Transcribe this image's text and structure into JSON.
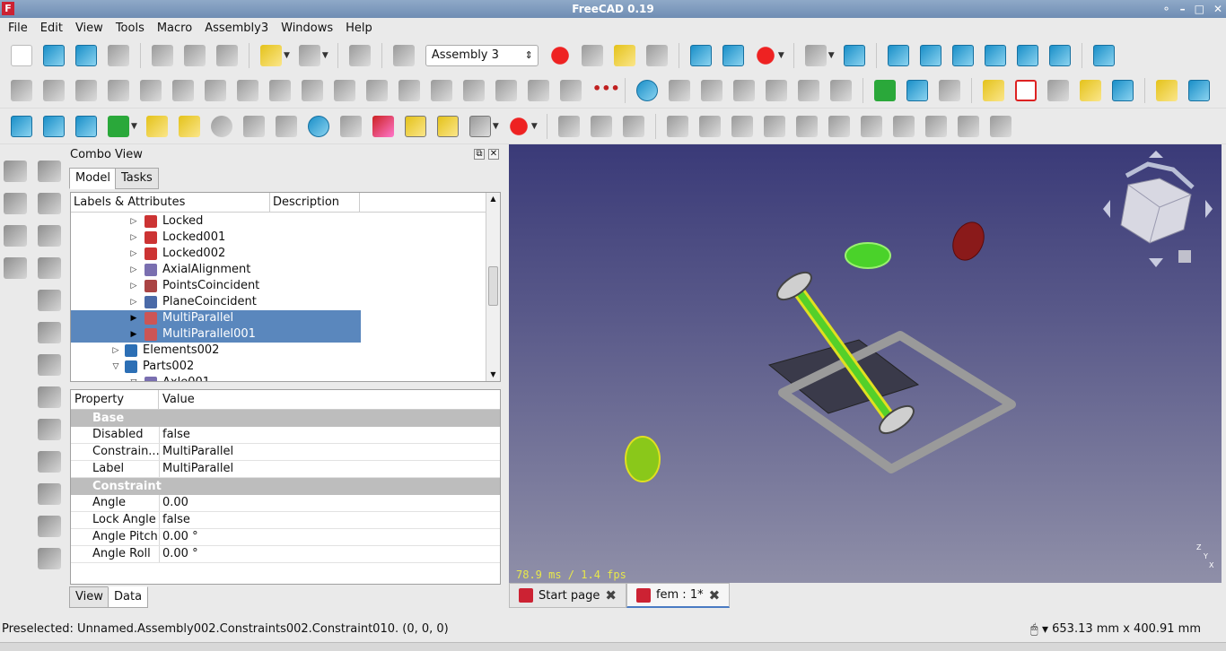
{
  "window": {
    "title": "FreeCAD 0.19",
    "app_icon": "F"
  },
  "menu": [
    "File",
    "Edit",
    "View",
    "Tools",
    "Macro",
    "Assembly3",
    "Windows",
    "Help"
  ],
  "toolbar": {
    "assembly_select": "Assembly 3"
  },
  "combo_view": {
    "title": "Combo View",
    "tabs": [
      "Model",
      "Tasks"
    ],
    "tree_headers": [
      "Labels & Attributes",
      "Description"
    ],
    "tree_items": [
      {
        "label": "Locked",
        "selected": false
      },
      {
        "label": "Locked001",
        "selected": false
      },
      {
        "label": "Locked002",
        "selected": false
      },
      {
        "label": "AxialAlignment",
        "selected": false
      },
      {
        "label": "PointsCoincident",
        "selected": false
      },
      {
        "label": "PlaneCoincident",
        "selected": false
      },
      {
        "label": "MultiParallel",
        "selected": true
      },
      {
        "label": "MultiParallel001",
        "selected": true
      },
      {
        "label": "Elements002",
        "selected": false
      },
      {
        "label": "Parts002",
        "selected": false
      },
      {
        "label": "Axle001",
        "selected": false
      }
    ],
    "prop_headers": [
      "Property",
      "Value"
    ],
    "groups": [
      {
        "name": "Base",
        "rows": [
          {
            "key": "Disabled",
            "value": "false"
          },
          {
            "key": "Constrain...",
            "value": "MultiParallel"
          },
          {
            "key": "Label",
            "value": "MultiParallel"
          }
        ]
      },
      {
        "name": "Constraint",
        "rows": [
          {
            "key": "Angle",
            "value": "0.00"
          },
          {
            "key": "Lock Angle",
            "value": "false"
          },
          {
            "key": "Angle Pitch",
            "value": "0.00 °"
          },
          {
            "key": "Angle Roll",
            "value": "0.00 °"
          }
        ]
      }
    ],
    "bottom_tabs": [
      "View",
      "Data"
    ]
  },
  "viewport": {
    "fps": "78.9 ms / 1.4 fps",
    "axes": [
      "Z",
      "Y",
      "X"
    ]
  },
  "view_tabs": [
    {
      "label": "Start page"
    },
    {
      "label": "fem : 1*"
    }
  ],
  "status": {
    "preselected": "Preselected: Unnamed.Assembly002.Constraints002.Constraint010. (0, 0, 0)",
    "dimensions": "653.13 mm x 400.91 mm"
  }
}
